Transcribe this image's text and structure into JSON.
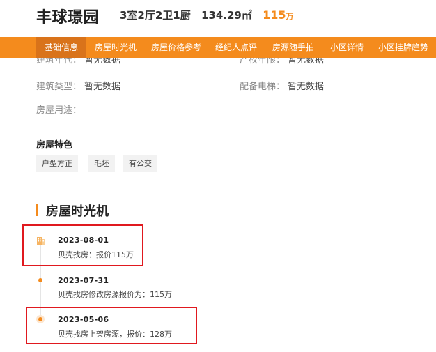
{
  "header": {
    "title": "丰球璟园",
    "layout": "3室2厅2卫1厨",
    "area": "134.29㎡",
    "price": "115",
    "price_unit": "万"
  },
  "nav": {
    "items": [
      {
        "label": "基础信息",
        "active": true
      },
      {
        "label": "房屋时光机",
        "active": false
      },
      {
        "label": "房屋价格参考",
        "active": false
      },
      {
        "label": "经纪人点评",
        "active": false
      },
      {
        "label": "房源随手拍",
        "active": false
      },
      {
        "label": "小区详情",
        "active": false
      },
      {
        "label": "小区挂牌趋势",
        "active": false
      }
    ]
  },
  "basic_info": {
    "cut_left_label": "建筑年代：",
    "cut_left_value": "暂无数据",
    "cut_right_label": "产权年限：",
    "cut_right_value": "暂无数据",
    "building_type_label": "建筑类型：",
    "building_type_value": "暂无数据",
    "elevator_label": "配备电梯：",
    "elevator_value": "暂无数据",
    "usage_label": "房屋用途："
  },
  "features": {
    "title": "房屋特色",
    "tags": [
      "户型方正",
      "毛坯",
      "有公交"
    ]
  },
  "timeline": {
    "title": "房屋时光机",
    "events": [
      {
        "date": "2023-08-01",
        "desc": "贝壳找房：报价115万"
      },
      {
        "date": "2023-07-31",
        "desc": "贝壳找房修改房源报价为：115万"
      },
      {
        "date": "2023-05-06",
        "desc": "贝壳找房上架房源，报价：128万"
      }
    ]
  },
  "colors": {
    "accent": "#f48b1d",
    "nav_active": "#d9731a",
    "highlight_box": "#e0191f"
  }
}
